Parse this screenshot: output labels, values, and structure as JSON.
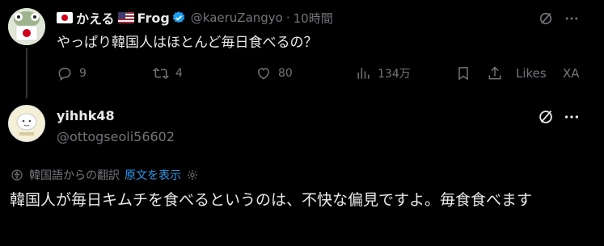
{
  "post1": {
    "display_name": "かえる",
    "display_name_suffix": "Frog",
    "handle": "@kaeruZangyo",
    "separator": "·",
    "time": "10時間",
    "text": "やっぱり韓国人はほとんど毎日食べるの？",
    "actions": {
      "replies": "9",
      "reposts": "4",
      "likes": "80",
      "views": "134万",
      "likes_label": "Likes",
      "xa_label": "XA"
    }
  },
  "post2": {
    "display_name": "yihhk48",
    "handle": "@ottogseoli56602",
    "translation_note": "韓国語からの翻訳",
    "show_original": "原文を表示",
    "text": "韓国人が毎日キムチを食べるというのは、不快な偏見ですよ。毎食食べます"
  },
  "colors": {
    "background": "#000000",
    "text": "#e7e9ea",
    "muted": "#71767b",
    "link": "#1d9bf0"
  }
}
